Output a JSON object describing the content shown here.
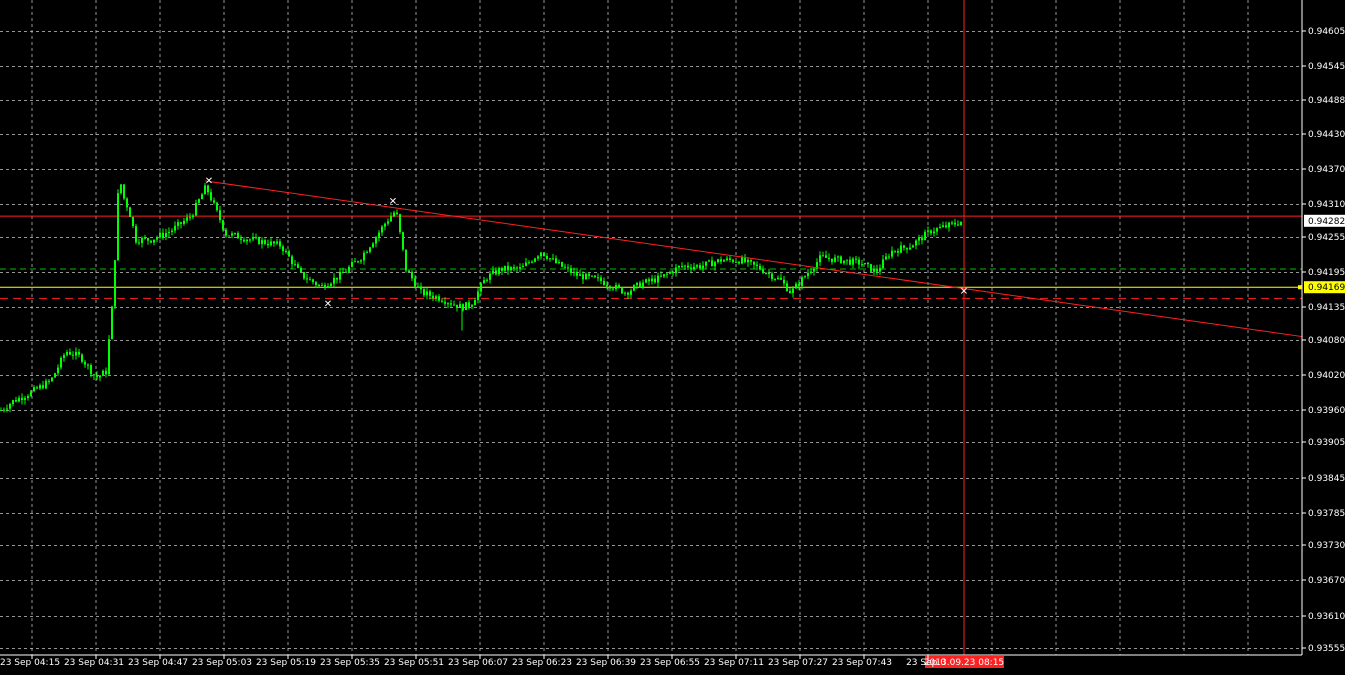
{
  "colors": {
    "background": "#000000",
    "grid": "#c8c8c8",
    "bull": "#00ff00",
    "axis_text": "#ffffff",
    "trendline": "#ff2020",
    "crosshair": "#ff2020",
    "bid_line": "#ffff00",
    "level_green": "#00c000",
    "level_red": "#ff2020"
  },
  "chart_data": {
    "type": "candlestick",
    "x_labels": [
      "23 Sep 04:15",
      "23 Sep 04:31",
      "23 Sep 04:47",
      "23 Sep 05:03",
      "23 Sep 05:19",
      "23 Sep 05:35",
      "23 Sep 05:51",
      "23 Sep 06:07",
      "23 Sep 06:23",
      "23 Sep 06:39",
      "23 Sep 06:55",
      "23 Sep 07:11",
      "23 Sep 07:27",
      "23 Sep 07:43",
      "23 Sep 0"
    ],
    "y_ticks": [
      "0.94605",
      "0.94545",
      "0.94488",
      "0.94430",
      "0.94370",
      "0.94310",
      "0.94255",
      "0.94195",
      "0.94135",
      "0.94080",
      "0.94020",
      "0.93960",
      "0.93905",
      "0.93845",
      "0.93785",
      "0.93730",
      "0.93670",
      "0.93610",
      "0.93555"
    ],
    "ylim": [
      0.93555,
      0.94635
    ],
    "price_close_path": [
      [
        0,
        0.9396
      ],
      [
        12,
        0.93975
      ],
      [
        30,
        0.9399
      ],
      [
        50,
        0.9401
      ],
      [
        65,
        0.9406
      ],
      [
        80,
        0.9405
      ],
      [
        95,
        0.94015
      ],
      [
        105,
        0.94025
      ],
      [
        112,
        0.9415
      ],
      [
        118,
        0.9436
      ],
      [
        123,
        0.9432
      ],
      [
        128,
        0.943
      ],
      [
        135,
        0.9425
      ],
      [
        150,
        0.9425
      ],
      [
        170,
        0.94265
      ],
      [
        190,
        0.9429
      ],
      [
        205,
        0.9434
      ],
      [
        215,
        0.943
      ],
      [
        225,
        0.9426
      ],
      [
        250,
        0.9425
      ],
      [
        280,
        0.9424
      ],
      [
        300,
        0.9419
      ],
      [
        320,
        0.9417
      ],
      [
        340,
        0.9419
      ],
      [
        360,
        0.9422
      ],
      [
        375,
        0.94255
      ],
      [
        385,
        0.9428
      ],
      [
        395,
        0.943
      ],
      [
        405,
        0.942
      ],
      [
        420,
        0.9416
      ],
      [
        440,
        0.9415
      ],
      [
        460,
        0.94135
      ],
      [
        470,
        0.9414
      ],
      [
        485,
        0.94185
      ],
      [
        500,
        0.942
      ],
      [
        520,
        0.942
      ],
      [
        540,
        0.9423
      ],
      [
        555,
        0.9421
      ],
      [
        575,
        0.9419
      ],
      [
        600,
        0.9418
      ],
      [
        625,
        0.9416
      ],
      [
        640,
        0.94175
      ],
      [
        660,
        0.94185
      ],
      [
        680,
        0.94205
      ],
      [
        700,
        0.94205
      ],
      [
        720,
        0.94215
      ],
      [
        740,
        0.94215
      ],
      [
        760,
        0.942
      ],
      [
        780,
        0.9418
      ],
      [
        790,
        0.9416
      ],
      [
        805,
        0.9419
      ],
      [
        820,
        0.9422
      ],
      [
        840,
        0.94215
      ],
      [
        860,
        0.9421
      ],
      [
        875,
        0.94195
      ],
      [
        890,
        0.9423
      ],
      [
        910,
        0.9424
      ],
      [
        930,
        0.94265
      ],
      [
        950,
        0.94275
      ],
      [
        962,
        0.94282
      ]
    ],
    "low_spike": {
      "x": 462,
      "value": 0.94095
    },
    "trendline": {
      "from": [
        205,
        0.9435
      ],
      "to": [
        1302,
        0.94085
      ]
    },
    "current_price": "0.94282",
    "bid_price": "0.94169",
    "level_red_solid": 0.9429,
    "level_green_dashed": 0.942,
    "level_red_dashed": 0.9415,
    "crosshair_label": "2013.09.23 08:15"
  }
}
